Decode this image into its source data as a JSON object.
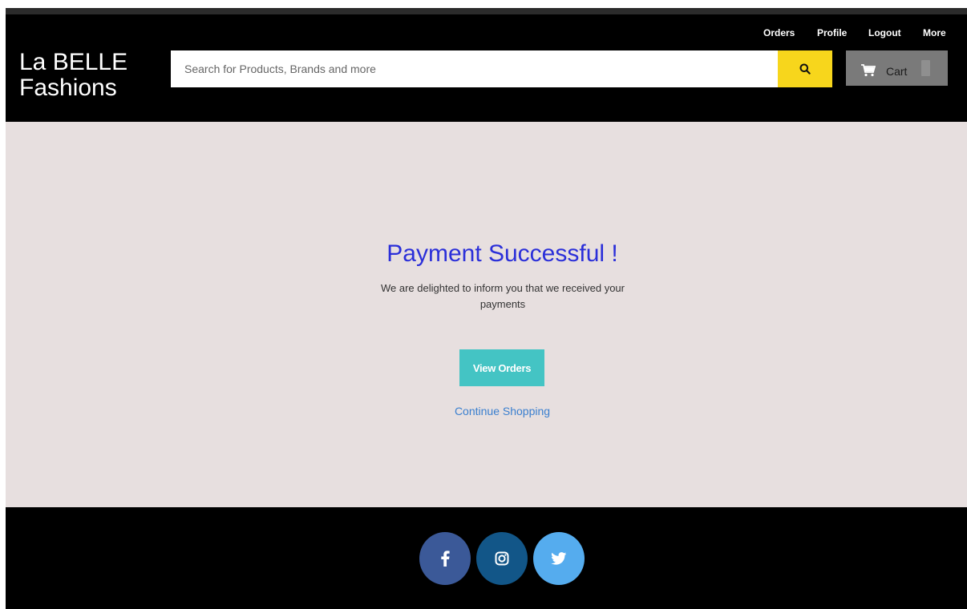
{
  "brand": {
    "line1": "La BELLE",
    "line2": "Fashions"
  },
  "search": {
    "placeholder": "Search for Products, Brands and more",
    "value": "",
    "button_icon": "search-icon"
  },
  "cart": {
    "label": "Cart",
    "icon": "cart-icon"
  },
  "nav": {
    "items": [
      {
        "label": "Orders"
      },
      {
        "label": "Profile"
      },
      {
        "label": "Logout"
      },
      {
        "label": "More"
      }
    ]
  },
  "main": {
    "title": "Payment Successful !",
    "message": "We are delighted to inform you that we received your payments",
    "view_orders_label": "View Orders",
    "continue_label": "Continue Shopping"
  },
  "footer": {
    "social": [
      {
        "icon": "facebook-icon",
        "color": "#3b5998"
      },
      {
        "icon": "instagram-icon",
        "color": "#125688"
      },
      {
        "icon": "twitter-icon",
        "color": "#55acee"
      }
    ]
  },
  "colors": {
    "header_bg": "#000000",
    "search_button": "#f7d61c",
    "cart_button": "#7a7a7a",
    "main_bg": "#e7dfdf",
    "title": "#2b2fd9",
    "view_orders_button": "#44c4c4",
    "link": "#3a7fcf"
  }
}
